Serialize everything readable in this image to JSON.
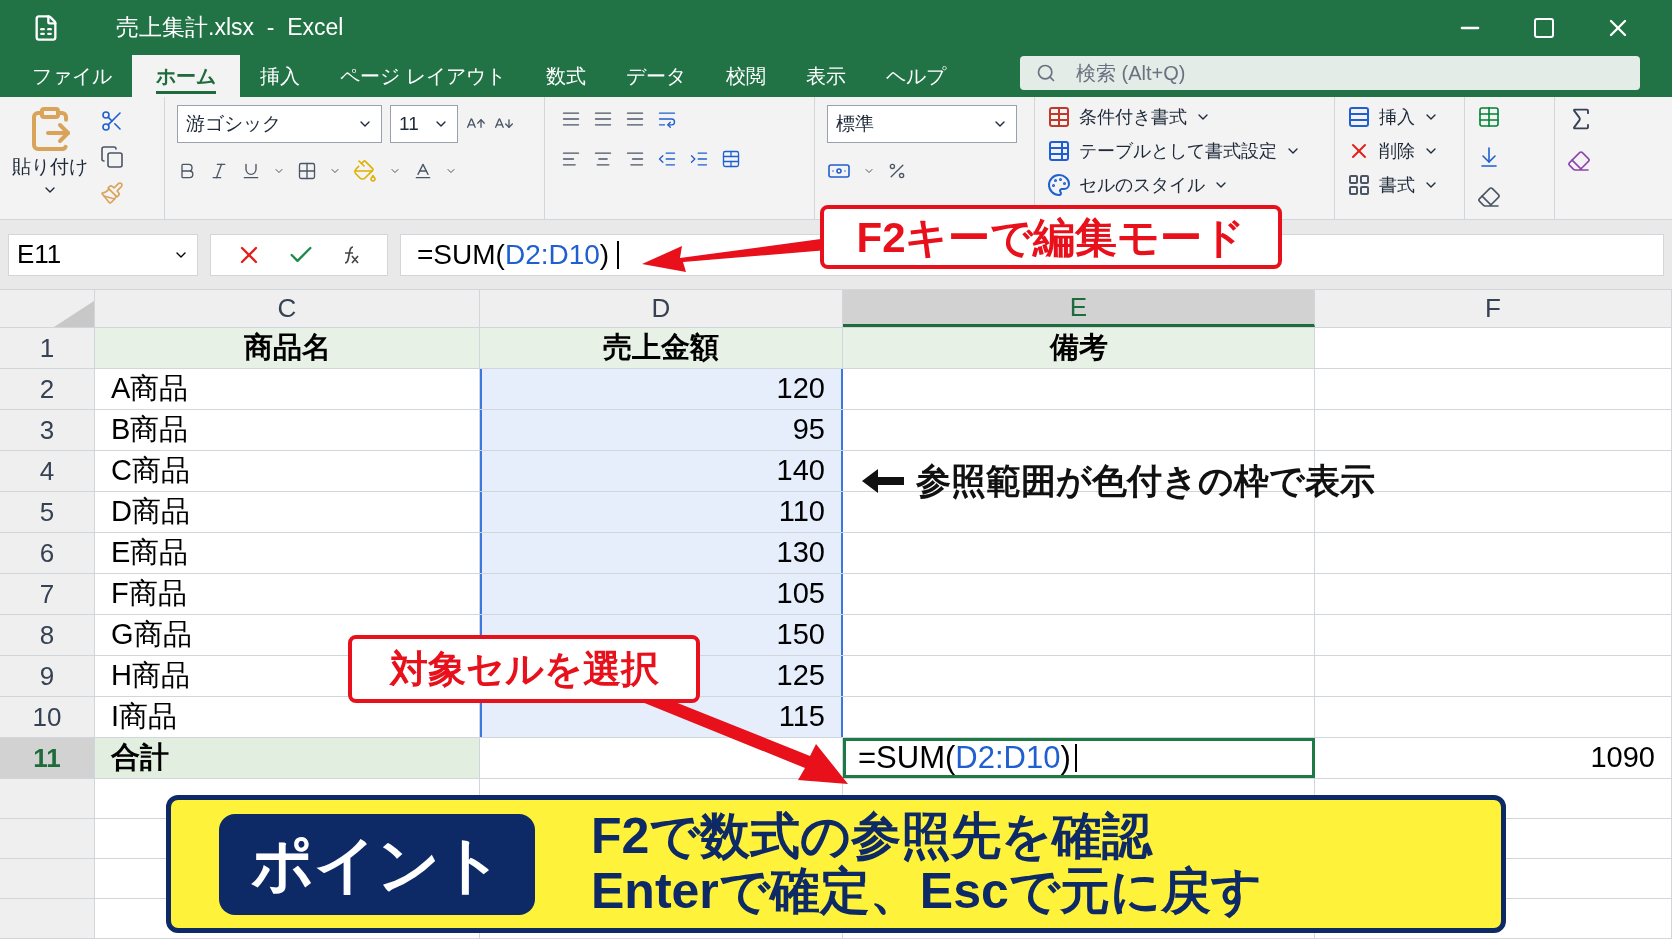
{
  "window": {
    "title": "売上集計.xlsx  -  Excel"
  },
  "tabs": [
    {
      "label": "ファイル",
      "selected": false
    },
    {
      "label": "ホーム",
      "selected": true
    },
    {
      "label": "挿入",
      "selected": false
    },
    {
      "label": "ページ レイアウト",
      "selected": false
    },
    {
      "label": "数式",
      "selected": false
    },
    {
      "label": "データ",
      "selected": false
    },
    {
      "label": "校閲",
      "selected": false
    },
    {
      "label": "表示",
      "selected": false
    },
    {
      "label": "ヘルプ",
      "selected": false
    }
  ],
  "search": {
    "placeholder": "検索 (Alt+Q)"
  },
  "ribbon": {
    "paste": "貼り付け",
    "font_name": "游ゴシック",
    "font_size": "11",
    "number_format": "標準",
    "styles": [
      "条件付き書式",
      "テーブルとして書式設定",
      "セルのスタイル"
    ],
    "cells": [
      "挿入",
      "削除",
      "書式"
    ]
  },
  "formula_bar": {
    "name_box": "E11",
    "prefix": "=SUM(",
    "reference": "D2:D10",
    "suffix": ")"
  },
  "columns": [
    {
      "label": "C",
      "selected": false
    },
    {
      "label": "D",
      "selected": false
    },
    {
      "label": "E",
      "selected": true
    },
    {
      "label": "F",
      "selected": false
    }
  ],
  "rows": [
    {
      "number": "1",
      "selected": false,
      "referenced": false,
      "cells": [
        "商品名",
        "売上金額",
        "備考",
        ""
      ]
    },
    {
      "number": "2",
      "selected": false,
      "referenced": true,
      "cells": [
        "A商品",
        "120",
        "",
        ""
      ]
    },
    {
      "number": "3",
      "selected": false,
      "referenced": true,
      "cells": [
        "B商品",
        "95",
        "",
        ""
      ]
    },
    {
      "number": "4",
      "selected": false,
      "referenced": true,
      "cells": [
        "C商品",
        "140",
        "",
        ""
      ]
    },
    {
      "number": "5",
      "selected": false,
      "referenced": true,
      "cells": [
        "D商品",
        "110",
        "",
        ""
      ]
    },
    {
      "number": "6",
      "selected": false,
      "referenced": true,
      "cells": [
        "E商品",
        "130",
        "",
        ""
      ]
    },
    {
      "number": "7",
      "selected": false,
      "referenced": true,
      "cells": [
        "F商品",
        "105",
        "",
        ""
      ]
    },
    {
      "number": "8",
      "selected": false,
      "referenced": true,
      "cells": [
        "G商品",
        "150",
        "",
        ""
      ]
    },
    {
      "number": "9",
      "selected": false,
      "referenced": true,
      "cells": [
        "H商品",
        "125",
        "",
        ""
      ]
    },
    {
      "number": "10",
      "selected": false,
      "referenced": true,
      "cells": [
        "I商品",
        "115",
        "",
        ""
      ]
    },
    {
      "number": "11",
      "selected": true,
      "referenced": false,
      "cells": [
        "合計",
        "",
        "",
        "1090"
      ]
    }
  ],
  "active_cell": {
    "prefix": "=SUM(",
    "reference": "D2:D10",
    "suffix": ")"
  },
  "callouts": [
    "F2キーで編集モード",
    "対象セルを選択"
  ],
  "note": "参照範囲が色付きの枠で表示",
  "point": {
    "badge": "ポイント",
    "lines": [
      "F2で数式の参照先を確認",
      "Enterで確定、Escで元に戻す"
    ]
  }
}
